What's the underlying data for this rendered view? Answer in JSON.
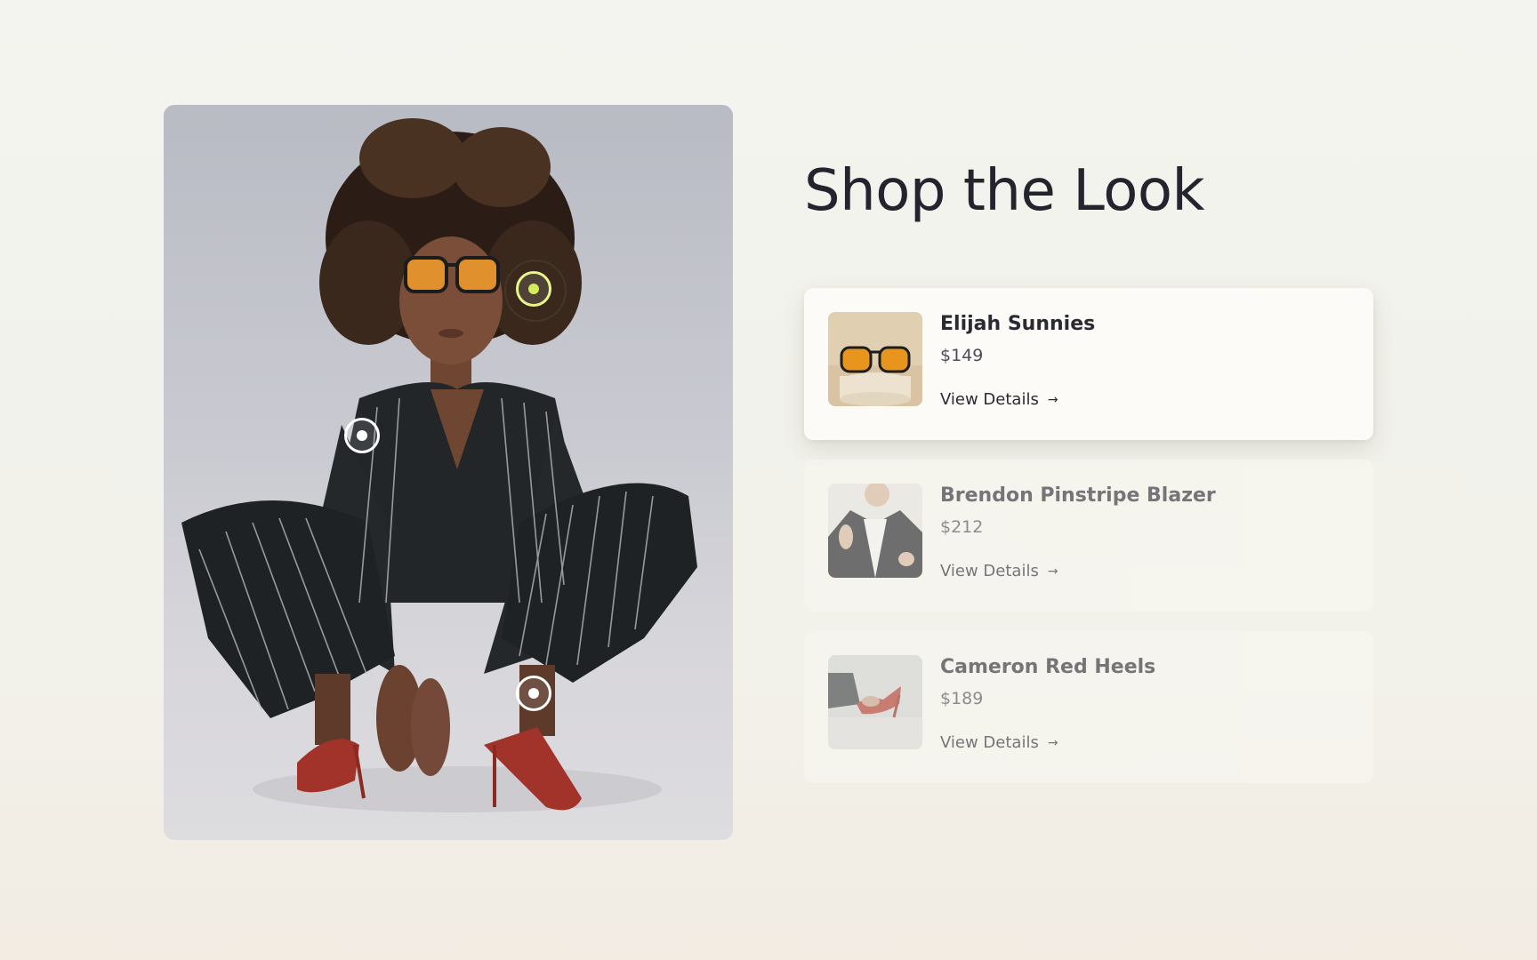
{
  "heading": "Shop the Look",
  "hotspots": [
    {
      "name": "hotspot-sunglasses",
      "active": true
    },
    {
      "name": "hotspot-blazer",
      "active": false
    },
    {
      "name": "hotspot-heels",
      "active": false
    }
  ],
  "products": [
    {
      "name": "Elijah Sunnies",
      "price": "$149",
      "link_label": "View Details",
      "link_icon": "→",
      "icon": "sunglasses-thumbnail",
      "active": true
    },
    {
      "name": "Brendon Pinstripe Blazer",
      "price": "$212",
      "link_label": "View Details",
      "link_icon": "→",
      "icon": "blazer-thumbnail",
      "active": false
    },
    {
      "name": "Cameron Red Heels",
      "price": "$189",
      "link_label": "View Details",
      "link_icon": "→",
      "icon": "heels-thumbnail",
      "active": false
    }
  ],
  "colors": {
    "background": "#f3f4ef",
    "card_active": "#fcfbf7",
    "accent_hotspot": "#d3ec59",
    "text_primary": "#24242f"
  }
}
